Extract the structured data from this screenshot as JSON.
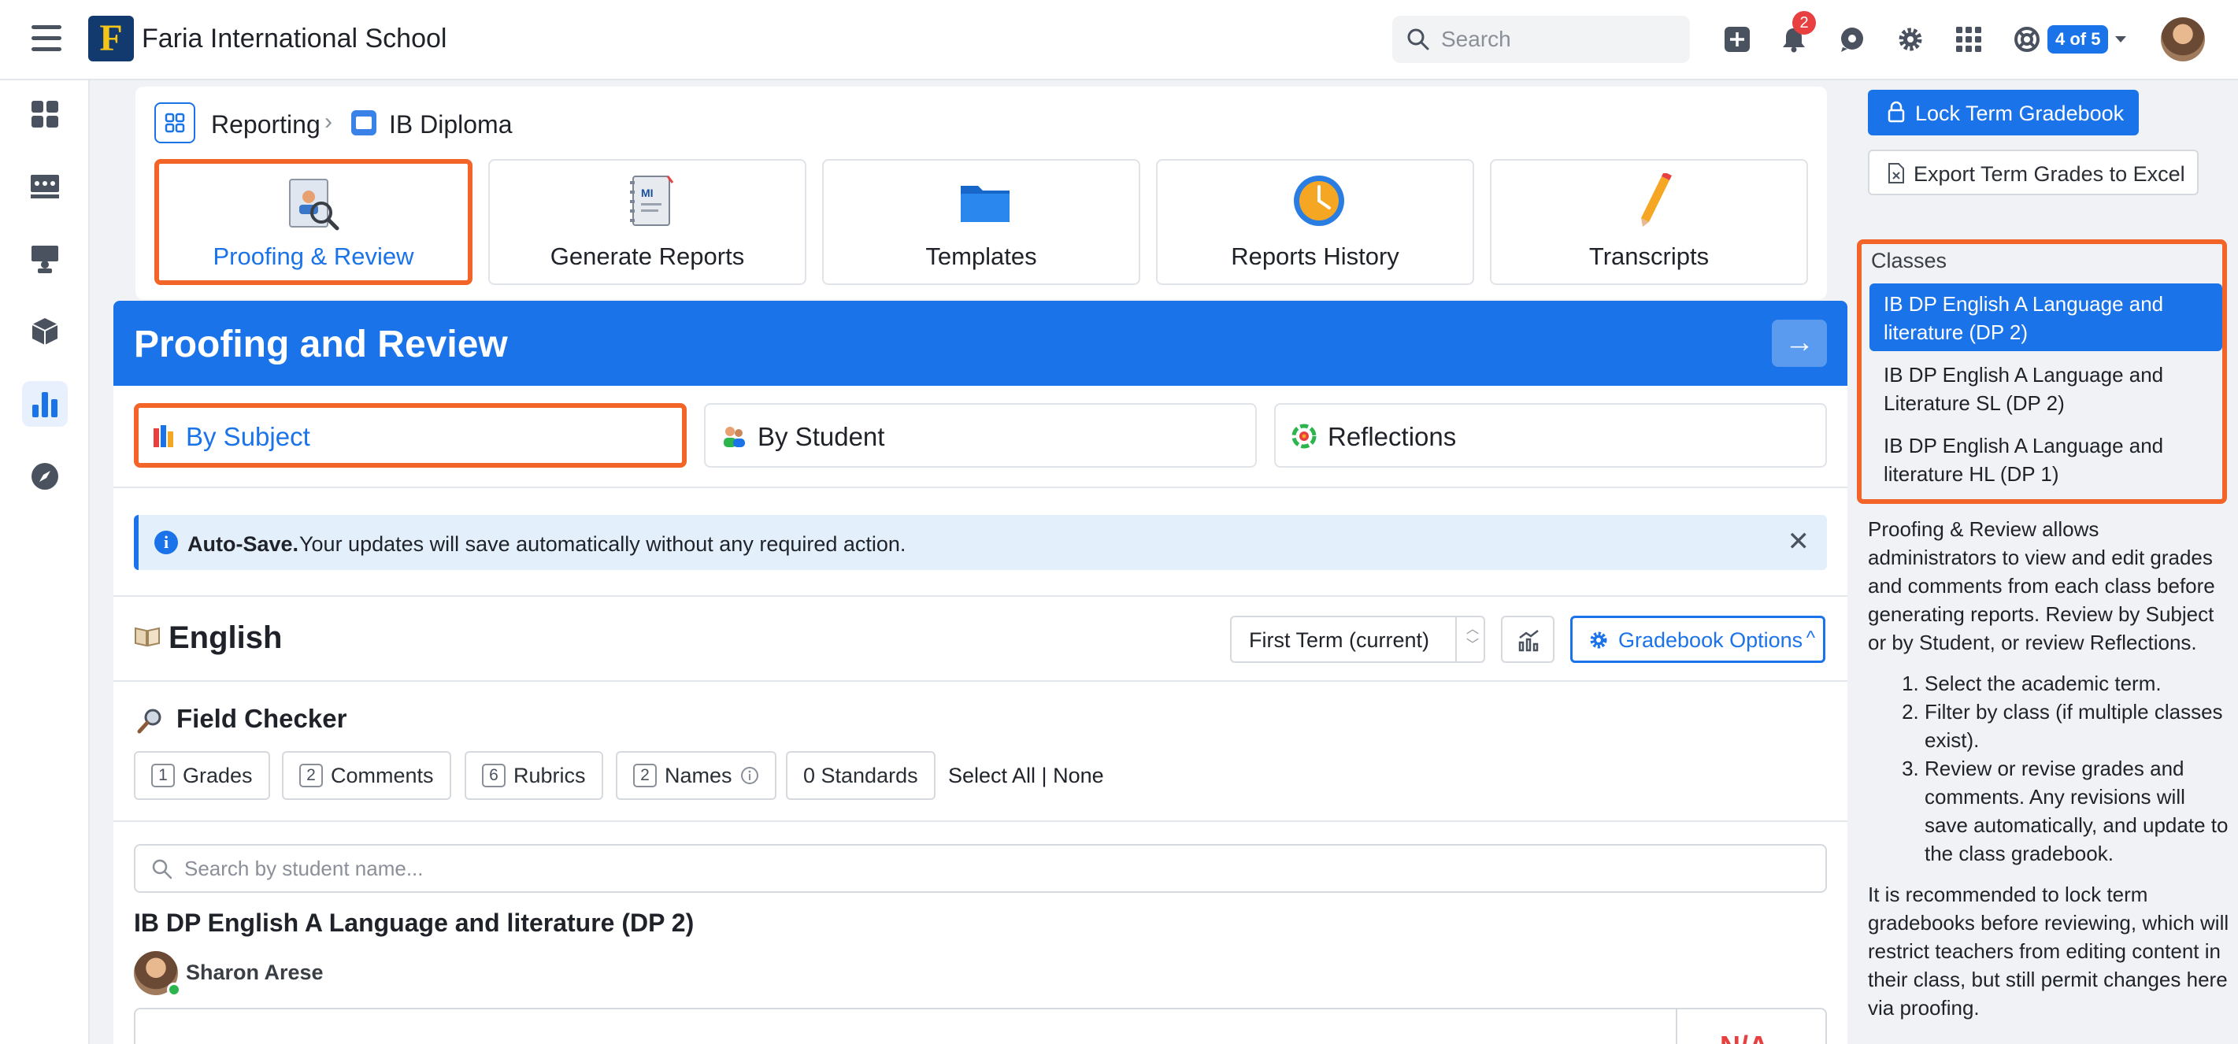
{
  "header": {
    "app_title": "Faria International School",
    "logo_letter": "F",
    "search_placeholder": "Search",
    "notifications_count": "2",
    "account_pill": "4 of 5"
  },
  "breadcrumb": {
    "root": "Reporting",
    "current": "IB Diploma"
  },
  "tiles": [
    {
      "label": "Proofing & Review"
    },
    {
      "label": "Generate Reports"
    },
    {
      "label": "Templates"
    },
    {
      "label": "Reports History"
    },
    {
      "label": "Transcripts"
    }
  ],
  "page": {
    "title": "Proofing and Review"
  },
  "subtabs": [
    {
      "label": "By Subject"
    },
    {
      "label": "By Student"
    },
    {
      "label": "Reflections"
    }
  ],
  "autosave": {
    "bold": "Auto-Save.",
    "text": "Your updates will save automatically without any required action."
  },
  "section": {
    "title": "English",
    "term": "First Term (current)",
    "gradebook_options": "Gradebook Options"
  },
  "field_checker": {
    "title": "Field Checker",
    "chips": [
      {
        "count": "1",
        "label": "Grades"
      },
      {
        "count": "2",
        "label": "Comments"
      },
      {
        "count": "6",
        "label": "Rubrics"
      },
      {
        "count": "2",
        "label": "Names"
      },
      {
        "count": "",
        "label": "0 Standards"
      }
    ],
    "select_all": "Select All | None"
  },
  "student_search_placeholder": "Search by student name...",
  "class_heading": "IB DP English A Language and literature (DP 2)",
  "teacher_name": "Sharon Arese",
  "grade_value": "N/A",
  "right_panel": {
    "lock_label": "Lock Term Gradebook",
    "export_label": "Export Term Grades to Excel",
    "classes_label": "Classes",
    "classes": [
      "IB DP English A Language and literature (DP 2)",
      "IB DP English A Language and Literature SL (DP 2)",
      "IB DP English A Language and literature HL (DP 1)"
    ],
    "help_intro": "Proofing & Review allows administrators to view and edit grades and comments from each class before generating reports. Review by Subject or by Student, or review Reflections.",
    "help_steps": [
      "Select the academic term.",
      "Filter by class (if multiple classes exist).",
      "Review or revise grades and comments. Any revisions will save automatically, and update to the class gradebook."
    ],
    "help_outro": "It is recommended to lock term gradebooks before reviewing, which will restrict teachers from editing content in their class, but still permit changes here via proofing."
  },
  "colors": {
    "accent": "#1a73e8",
    "highlight": "#f26427",
    "notification": "#e84040",
    "online": "#2bb54c"
  }
}
